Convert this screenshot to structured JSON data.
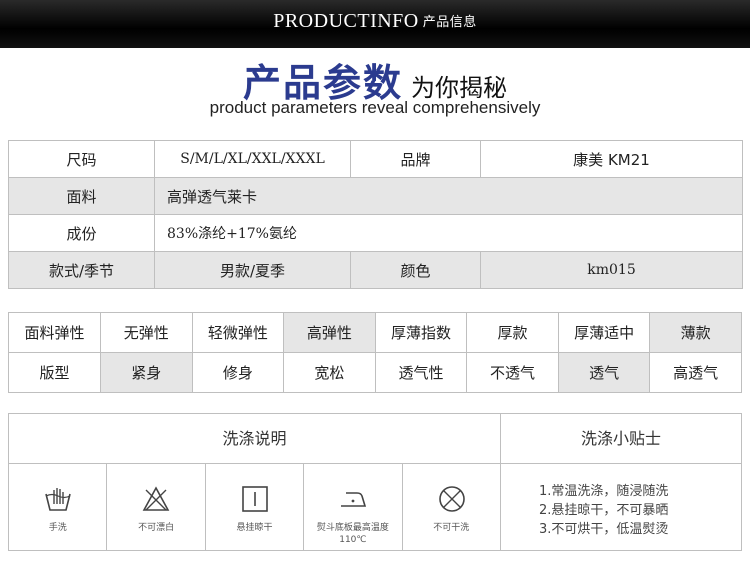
{
  "header": {
    "title_en": "PRODUCTINFO",
    "title_cn": "产品信息"
  },
  "hero": {
    "title_bold": "产品参数",
    "title_rest": "为你揭秘",
    "subtitle": "product parameters reveal comprehensively"
  },
  "params": {
    "size_label": "尺码",
    "size_value": "S/M/L/XL/XXL/XXXL",
    "brand_label": "品牌",
    "brand_value": "康美 KM21",
    "fabric_label": "面料",
    "fabric_value": "高弹透气莱卡",
    "composition_label": "成份",
    "composition_value": "83%涤纶+17%氨纶",
    "style_label": "款式/季节",
    "style_value": "男款/夏季",
    "color_label": "颜色",
    "color_value": "km015"
  },
  "attributes": {
    "row1": [
      "面料弹性",
      "无弹性",
      "轻微弹性",
      "高弹性",
      "厚薄指数",
      "厚款",
      "厚薄适中",
      "薄款"
    ],
    "row2": [
      "版型",
      "紧身",
      "修身",
      "宽松",
      "透气性",
      "不透气",
      "透气",
      "高透气"
    ]
  },
  "wash": {
    "header": "洗涤说明",
    "tips_header": "洗涤小贴士",
    "icons": [
      {
        "name": "hand-wash-icon",
        "label": "手洗"
      },
      {
        "name": "no-bleach-icon",
        "label": "不可漂白"
      },
      {
        "name": "hang-dry-icon",
        "label": "悬挂晾干"
      },
      {
        "name": "iron-icon",
        "label": "熨斗底板最高温度110℃"
      },
      {
        "name": "no-dry-clean-icon",
        "label": "不可干洗"
      }
    ],
    "tips": [
      "1.常温洗涤，随浸随洗",
      "2.悬挂晾干，不可暴晒",
      "3.不可烘干，低温熨烫"
    ]
  }
}
